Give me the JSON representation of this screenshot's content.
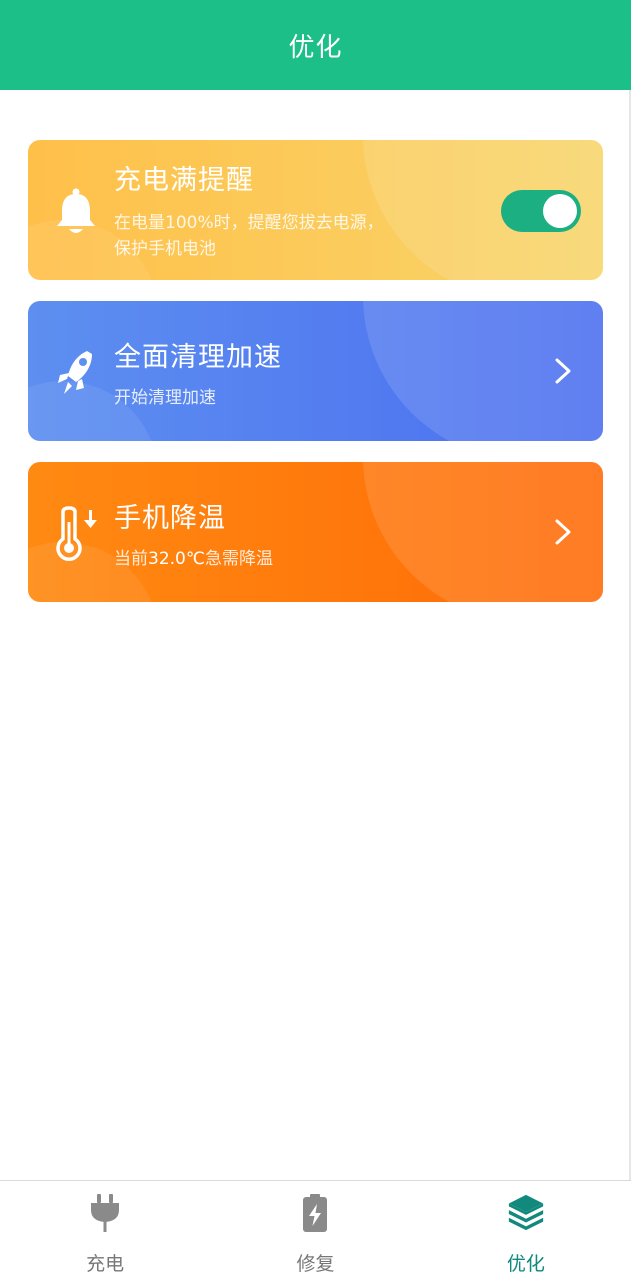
{
  "header": {
    "title": "优化"
  },
  "cards": {
    "charge_reminder": {
      "title": "充电满提醒",
      "desc_line1": "在电量100%时，提醒您拔去电源，",
      "desc_line2": "保护手机电池",
      "icon": "bell-icon",
      "toggle_on": true,
      "color_start": "#FFC04A",
      "color_end": "#F8D56A"
    },
    "clean": {
      "title": "全面清理加速",
      "desc": "开始清理加速",
      "icon": "rocket-icon",
      "color_start": "#5D8FF0",
      "color_end": "#4B6EF0"
    },
    "cool": {
      "title": "手机降温",
      "desc_prefix": "当前",
      "temperature": "32.0℃",
      "desc_suffix": "急需降温",
      "icon": "thermometer-down-icon",
      "color_start": "#FF8A12",
      "color_end": "#FF6A06"
    }
  },
  "bottom_nav": {
    "items": [
      {
        "label": "充电",
        "icon": "plug-icon",
        "active": false
      },
      {
        "label": "修复",
        "icon": "battery-bolt-icon",
        "active": false
      },
      {
        "label": "优化",
        "icon": "layers-icon",
        "active": true
      }
    ]
  },
  "colors": {
    "brand": "#1BBF87",
    "toggle_on": "#1BAF82",
    "nav_active": "#11897D",
    "nav_inactive": "#777777"
  }
}
